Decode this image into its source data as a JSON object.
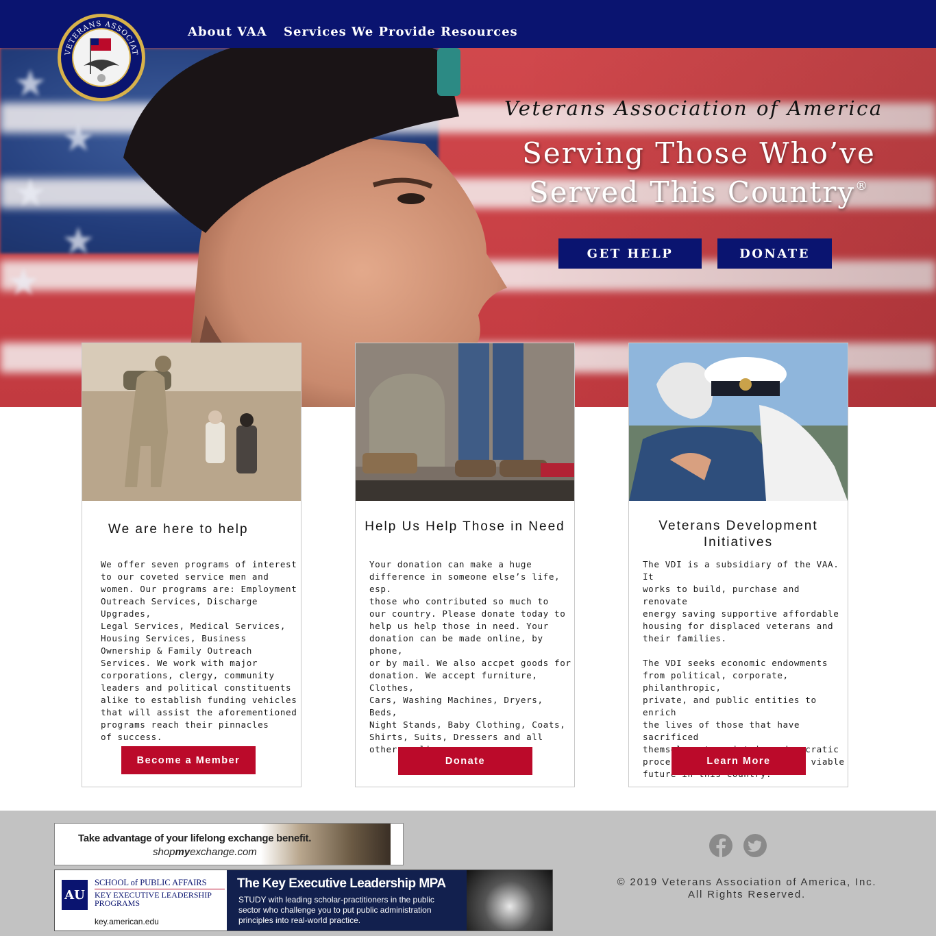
{
  "nav": {
    "logo_text": "VETERANS ASSOCIATION OF AMERICA, INC.",
    "links": [
      "About VAA",
      "Services We Provide",
      "Resources"
    ]
  },
  "hero": {
    "org_name": "Veterans Association of America",
    "tagline_line1": "Serving Those Who’ve",
    "tagline_line2": "Served This Country",
    "trademark": "®",
    "get_help_label": "GET HELP",
    "donate_label": "DONATE"
  },
  "cards": [
    {
      "title": "We are here to help",
      "body": "We offer seven programs of interest\nto our coveted service men and\nwomen. Our programs are: Employment\nOutreach Services, Discharge Upgrades,\nLegal Services, Medical Services,\nHousing Services, Business\nOwnership & Family Outreach\nServices. We work with major\ncorporations, clergy, community\nleaders and political constituents\nalike to establish funding vehicles\nthat will assist the aforementioned\nprograms reach their pinnacles\nof success.",
      "button": "Become a Member"
    },
    {
      "title": "Help Us Help Those in Need",
      "body": "Your donation can make a huge\ndifference in someone else’s life, esp.\nthose who contributed so much to\nour country. Please donate today to\nhelp us help those in need. Your\ndonation can be made online, by phone,\nor by mail. We also accpet goods for\ndonation. We accept furniture, Clothes,\nCars, Washing Machines, Dryers, Beds,\nNight Stands, Baby Clothing, Coats,\nShirts, Suits, Dressers and all\nother appliances.",
      "button": "Donate"
    },
    {
      "title_line1": "Veterans Development",
      "title_line2": "Initiatives",
      "body": "The VDI is a subsidiary of the VAA. It\nworks to build, purchase and renovate\nenergy saving supportive affordable\nhousing for displaced veterans and\ntheir families.\n\nThe VDI seeks economic endowments\nfrom political, corporate, philanthropic,\nprivate, and public entities to enrich\nthe lives of those that have sacrificed\nthemselves to maintain a democratic\nprocess for a sustainable and viable\nfuture in this country.",
      "button": "Learn More"
    }
  ],
  "footer": {
    "ad1": {
      "headline": "Take advantage of your lifelong exchange benefit.",
      "url_pre": "shop",
      "url_mid": "my",
      "url_post": "exchange.com"
    },
    "ad2": {
      "logo_letters": "AU",
      "school_line1": "SCHOOL of PUBLIC AFFAIRS",
      "school_line2": "KEY EXECUTIVE LEADERSHIP",
      "school_line3": "PROGRAMS",
      "url": "key.american.edu",
      "headline": "The Key Executive Leadership MPA",
      "body": "STUDY with leading scholar-practitioners in the public sector who challenge you to put public administration principles into real-world practice."
    },
    "social": [
      "facebook-icon",
      "twitter-icon"
    ],
    "copyright_line1": "© 2019 Veterans Association of America, Inc.",
    "copyright_line2": "All Rights Reserved."
  },
  "colors": {
    "nav_blue": "#0a1470",
    "button_red": "#bb0a2a",
    "footer_gray": "#c2c2c2"
  }
}
